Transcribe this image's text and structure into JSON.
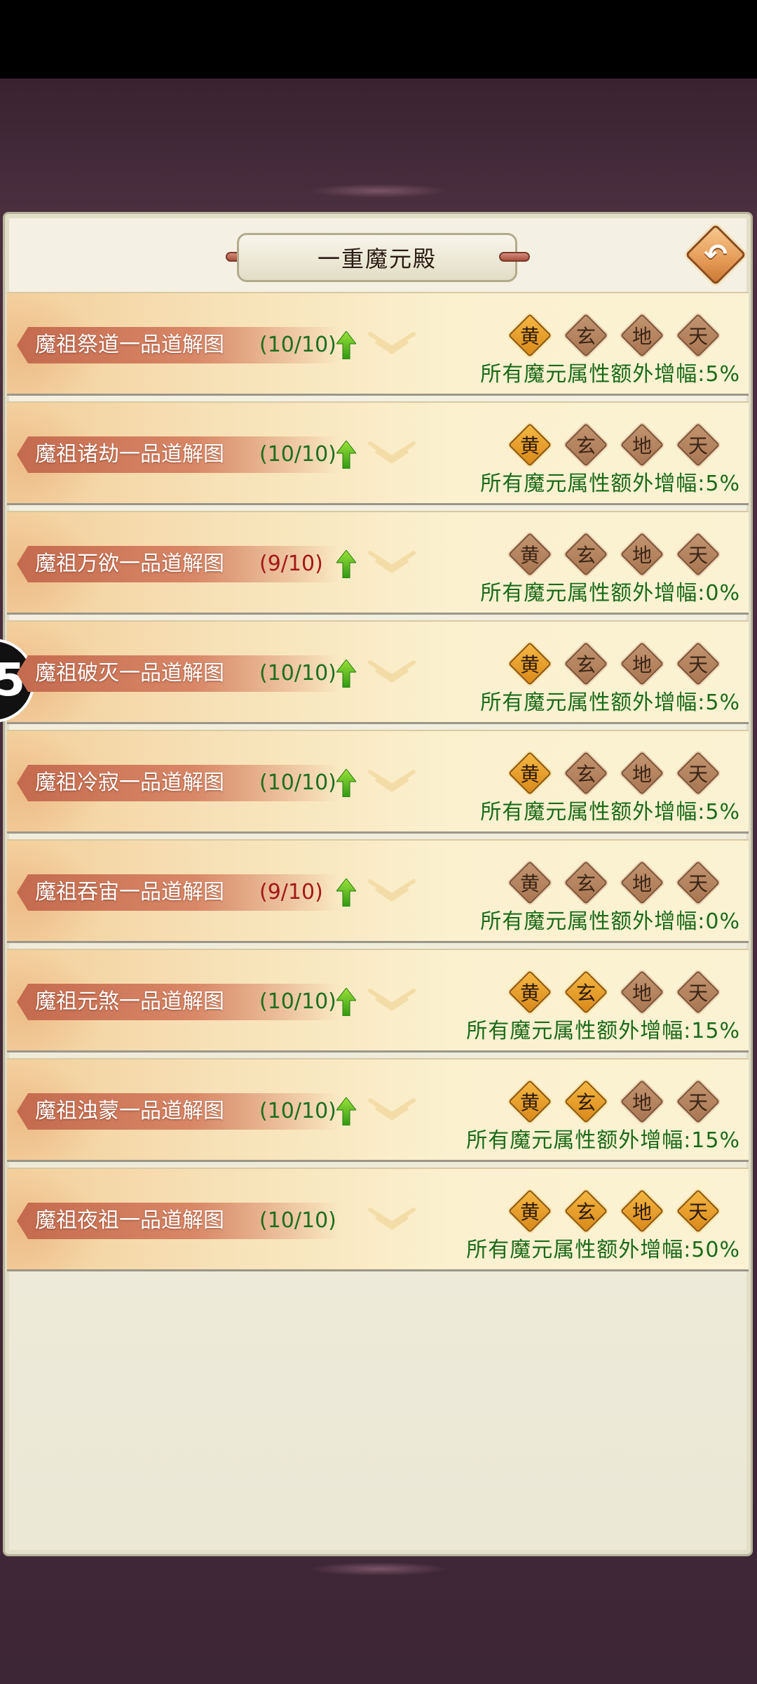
{
  "header": {
    "title": "一重魔元殿",
    "back_glyph": "↶"
  },
  "grades_labels": [
    "黄",
    "玄",
    "地",
    "天"
  ],
  "rows": [
    {
      "name": "魔祖祭道一品道解图",
      "progress": "(10/10)",
      "complete": true,
      "upgradable": true,
      "grades": [
        true,
        false,
        false,
        false
      ],
      "bonus": "所有魔元属性额外增幅:5%"
    },
    {
      "name": "魔祖诸劫一品道解图",
      "progress": "(10/10)",
      "complete": true,
      "upgradable": true,
      "grades": [
        true,
        false,
        false,
        false
      ],
      "bonus": "所有魔元属性额外增幅:5%"
    },
    {
      "name": "魔祖万欲一品道解图",
      "progress": "(9/10)",
      "complete": false,
      "upgradable": true,
      "grades": [
        false,
        false,
        false,
        false
      ],
      "bonus": "所有魔元属性额外增幅:0%"
    },
    {
      "name": "魔祖破灭一品道解图",
      "progress": "(10/10)",
      "complete": true,
      "upgradable": true,
      "grades": [
        true,
        false,
        false,
        false
      ],
      "bonus": "所有魔元属性额外增幅:5%"
    },
    {
      "name": "魔祖冷寂一品道解图",
      "progress": "(10/10)",
      "complete": true,
      "upgradable": true,
      "grades": [
        true,
        false,
        false,
        false
      ],
      "bonus": "所有魔元属性额外增幅:5%"
    },
    {
      "name": "魔祖吞宙一品道解图",
      "progress": "(9/10)",
      "complete": false,
      "upgradable": true,
      "grades": [
        false,
        false,
        false,
        false
      ],
      "bonus": "所有魔元属性额外增幅:0%"
    },
    {
      "name": "魔祖元煞一品道解图",
      "progress": "(10/10)",
      "complete": true,
      "upgradable": true,
      "grades": [
        true,
        true,
        false,
        false
      ],
      "bonus": "所有魔元属性额外增幅:15%"
    },
    {
      "name": "魔祖浊蒙一品道解图",
      "progress": "(10/10)",
      "complete": true,
      "upgradable": true,
      "grades": [
        true,
        true,
        false,
        false
      ],
      "bonus": "所有魔元属性额外增幅:15%"
    },
    {
      "name": "魔祖夜祖一品道解图",
      "progress": "(10/10)",
      "complete": true,
      "upgradable": false,
      "grades": [
        true,
        true,
        true,
        true
      ],
      "bonus": "所有魔元属性额外增幅:50%"
    }
  ],
  "side_badge": "5",
  "colors": {
    "complete_text": "#1e6e1e",
    "incomplete_text": "#a31818",
    "bonus_text": "#1a6a1a",
    "ribbon": "#c46a4e",
    "gem_on": "#e9a42e",
    "gem_off": "#b58460"
  }
}
